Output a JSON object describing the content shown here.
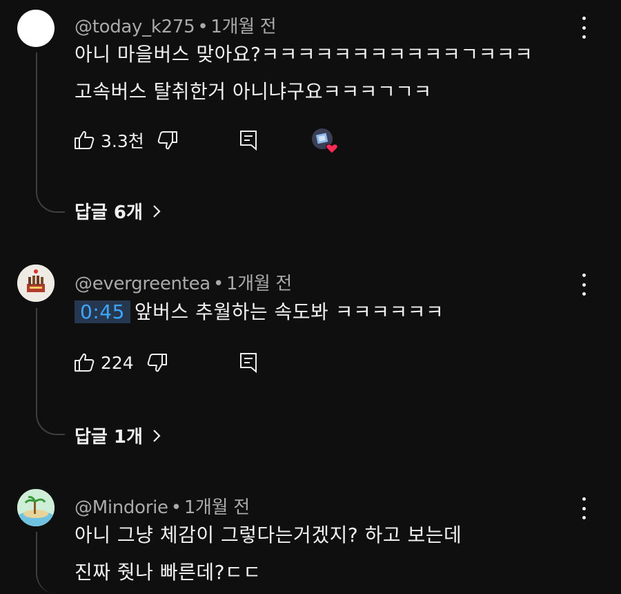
{
  "comments": [
    {
      "handle": "@today_k275",
      "separator": "•",
      "time": "1개월 전",
      "lines": [
        "아니 마을버스  맞아요?ㅋㅋㅋㅋㅋㅋㅋㅋㅋㅋㅋㄱㅋㅋㅋ",
        "고속버스 탈취한거 아니냐구요ㅋㅋㅋㄱㄱㅋ"
      ],
      "likes": "3.3천",
      "replies": "답글 6개"
    },
    {
      "handle": "@evergreentea",
      "separator": "•",
      "time": "1개월 전",
      "timestamp_link": "0:45",
      "lines": [
        "앞버스 추월하는 속도봐 ㅋㅋㅋㅋㅋㅋ"
      ],
      "likes": "224",
      "replies": "답글 1개"
    },
    {
      "handle": "@Mindorie",
      "separator": "•",
      "time": "1개월 전",
      "lines": [
        "아니 그냥 체감이 그렇다는거겠지? 하고 보는데",
        "진짜 줫나 빠른데?ㄷㄷ"
      ]
    }
  ],
  "colors": {
    "background": "#0f0f0f",
    "text": "#f1f1f1",
    "meta": "#aaaaaa",
    "link": "#3ea6ff",
    "heart": "#ff2d55"
  }
}
